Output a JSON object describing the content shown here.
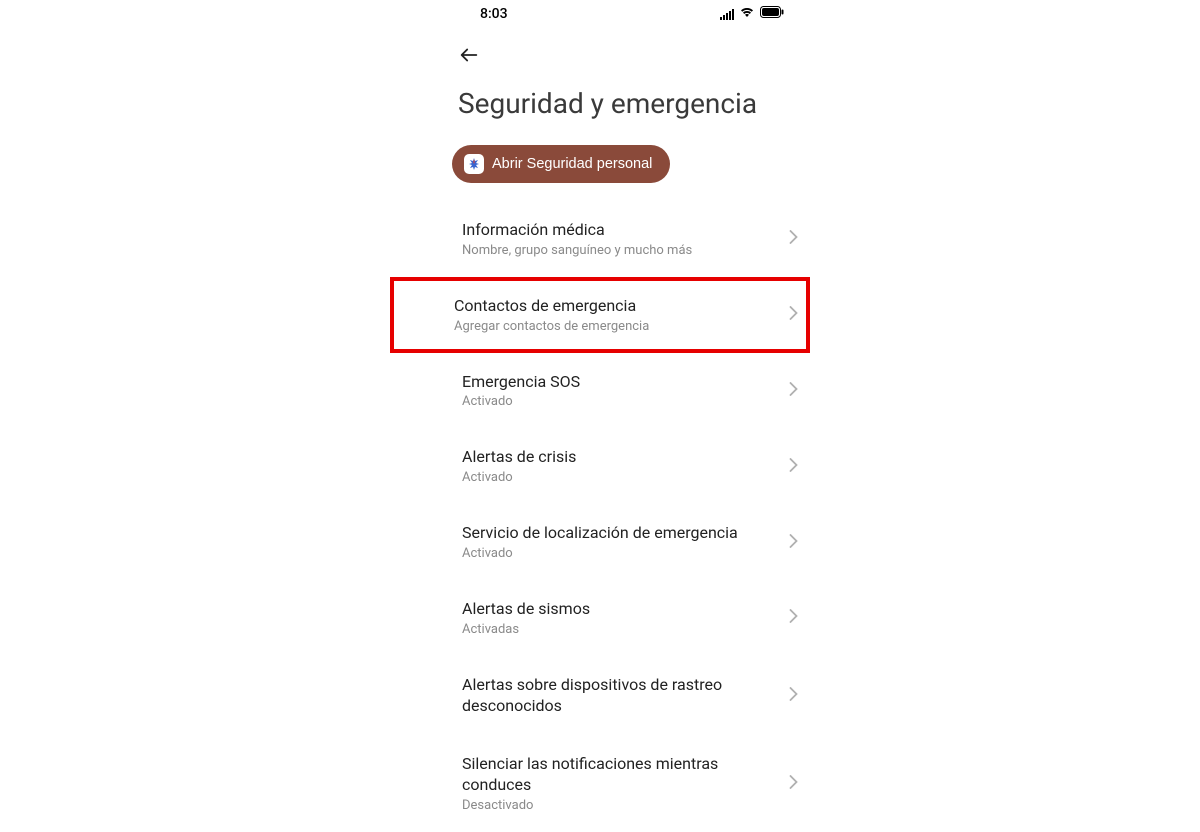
{
  "statusBar": {
    "time": "8:03"
  },
  "header": {
    "title": "Seguridad y emergencia"
  },
  "openButton": {
    "label": "Abrir Seguridad personal"
  },
  "items": [
    {
      "title": "Información médica",
      "subtitle": "Nombre, grupo sanguíneo y mucho más",
      "highlighted": false
    },
    {
      "title": "Contactos de emergencia",
      "subtitle": "Agregar contactos de emergencia",
      "highlighted": true
    },
    {
      "title": "Emergencia SOS",
      "subtitle": "Activado",
      "highlighted": false
    },
    {
      "title": "Alertas de crisis",
      "subtitle": "Activado",
      "highlighted": false
    },
    {
      "title": "Servicio de localización de emergencia",
      "subtitle": "Activado",
      "highlighted": false
    },
    {
      "title": "Alertas de sismos",
      "subtitle": "Activadas",
      "highlighted": false
    },
    {
      "title": "Alertas sobre dispositivos de rastreo desconocidos",
      "subtitle": "",
      "highlighted": false
    },
    {
      "title": "Silenciar las notificaciones mientras conduces",
      "subtitle": "Desactivado",
      "highlighted": false
    }
  ]
}
